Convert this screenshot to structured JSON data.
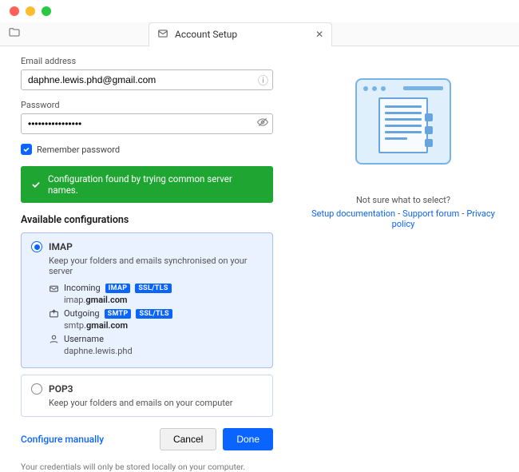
{
  "tab": {
    "title": "Account Setup"
  },
  "form": {
    "email_label": "Email address",
    "email_value": "daphne.lewis.phd@gmail.com",
    "password_label": "Password",
    "password_value": "••••••••••••••••",
    "remember_label": "Remember password"
  },
  "banner": "Configuration found by trying common server names.",
  "configs": {
    "heading": "Available configurations",
    "imap": {
      "title": "IMAP",
      "sub": "Keep your folders and emails synchronised on your server",
      "incoming": {
        "label": "Incoming",
        "badge1": "IMAP",
        "badge2": "SSL/TLS",
        "host_pre": "imap.",
        "host_bold": "gmail.com"
      },
      "outgoing": {
        "label": "Outgoing",
        "badge1": "SMTP",
        "badge2": "SSL/TLS",
        "host_pre": "smtp.",
        "host_bold": "gmail.com"
      },
      "username": {
        "label": "Username",
        "value": "daphne.lewis.phd"
      }
    },
    "pop3": {
      "title": "POP3",
      "sub": "Keep your folders and emails on your computer"
    }
  },
  "actions": {
    "manual": "Configure manually",
    "cancel": "Cancel",
    "done": "Done"
  },
  "footnote": "Your credentials will only be stored locally on your computer.",
  "help": {
    "title": "Not sure what to select?",
    "doc": "Setup documentation",
    "forum": "Support forum",
    "privacy": "Privacy policy"
  }
}
